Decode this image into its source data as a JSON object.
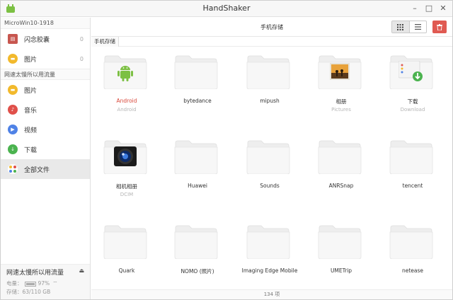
{
  "window": {
    "title": "HandShaker",
    "minimize": "–",
    "maximize": "□",
    "close": "✕"
  },
  "sidebar": {
    "device_section": "MicroWin10-1918",
    "device_items": [
      {
        "label": "闪念胶囊",
        "count": "0",
        "icon": "capsule-icon",
        "color": "#c7564f"
      },
      {
        "label": "图片",
        "count": "0",
        "icon": "picture-icon",
        "color": "#f2b92c"
      }
    ],
    "phone_section": "网速太慢所以用流量",
    "phone_items": [
      {
        "label": "图片",
        "icon": "picture-icon",
        "color": "#f2b92c"
      },
      {
        "label": "音乐",
        "icon": "music-icon",
        "color": "#e0504a"
      },
      {
        "label": "视频",
        "icon": "video-icon",
        "color": "#4f82e6"
      },
      {
        "label": "下载",
        "icon": "download-icon",
        "color": "#4bb34f"
      },
      {
        "label": "全部文件",
        "icon": "all-files-icon",
        "color": "#888888"
      }
    ],
    "device_info": {
      "name": "网速太慢所以用流量",
      "battery_label": "电量：",
      "battery_value": "97%",
      "storage_label": "存储：",
      "storage_value": "63/110 GB"
    }
  },
  "main": {
    "title": "手机存储",
    "breadcrumb": "手机存储",
    "footer": "134 项",
    "folders": [
      {
        "name": "Android",
        "sub": "Android",
        "emblem": "android-icon",
        "highlight": true
      },
      {
        "name": "bytedance",
        "sub": "",
        "emblem": ""
      },
      {
        "name": "mipush",
        "sub": "",
        "emblem": ""
      },
      {
        "name": "相册",
        "sub": "Pictures",
        "emblem": "pictures-icon"
      },
      {
        "name": "下载",
        "sub": "Download",
        "emblem": "download-icon"
      },
      {
        "name": "相机相册",
        "sub": "DCIM",
        "emblem": "camera-icon"
      },
      {
        "name": "Huawei",
        "sub": "",
        "emblem": ""
      },
      {
        "name": "Sounds",
        "sub": "",
        "emblem": ""
      },
      {
        "name": "ANRSnap",
        "sub": "",
        "emblem": ""
      },
      {
        "name": "tencent",
        "sub": "",
        "emblem": ""
      },
      {
        "name": "Quark",
        "sub": "",
        "emblem": ""
      },
      {
        "name": "NOMO (照片)",
        "sub": "",
        "emblem": ""
      },
      {
        "name": "Imaging Edge Mobile",
        "sub": "",
        "emblem": ""
      },
      {
        "name": "UMETrip",
        "sub": "",
        "emblem": ""
      },
      {
        "name": "netease",
        "sub": "",
        "emblem": ""
      }
    ]
  },
  "colors": {
    "accent_red": "#d9483b",
    "delete_red": "#e05a52",
    "selected_bg": "#e9e9e9"
  }
}
